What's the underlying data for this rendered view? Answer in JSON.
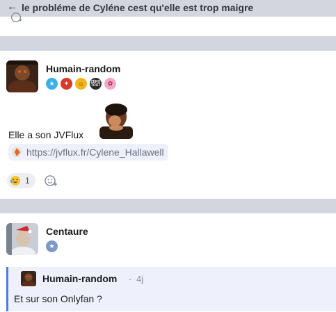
{
  "header": {
    "back_icon": "arrow-left-icon",
    "title": "le probléme de Cyléne cest qu'elle est trop maigre"
  },
  "posts": [
    {
      "author": "Humain-random",
      "badges": [
        "star-badge-icon",
        "fire-badge-icon",
        "gold-badge-icon",
        "zero-tout-badge-icon",
        "pink-badge-icon"
      ],
      "badge_labels": {
        "zero_tout": "ZÉRO TOUT"
      },
      "text": "Elle a son JVFlux",
      "link": "https://jvflux.fr/Cylene_Hallawell",
      "reaction": {
        "icon": "crying-laughing-emoji-icon",
        "count": "1"
      }
    },
    {
      "author": "Centaure",
      "badges": [
        "star-badge-icon"
      ],
      "quote": {
        "author": "Humain-random",
        "separator": "·",
        "time": "4j",
        "text": "Et sur son Onlyfan ?"
      }
    }
  ],
  "colors": {
    "header_bg": "#d4d6df",
    "quote_bg": "#eef1fb",
    "quote_border": "#4f7ddb",
    "link_bg": "#eef1fb"
  }
}
